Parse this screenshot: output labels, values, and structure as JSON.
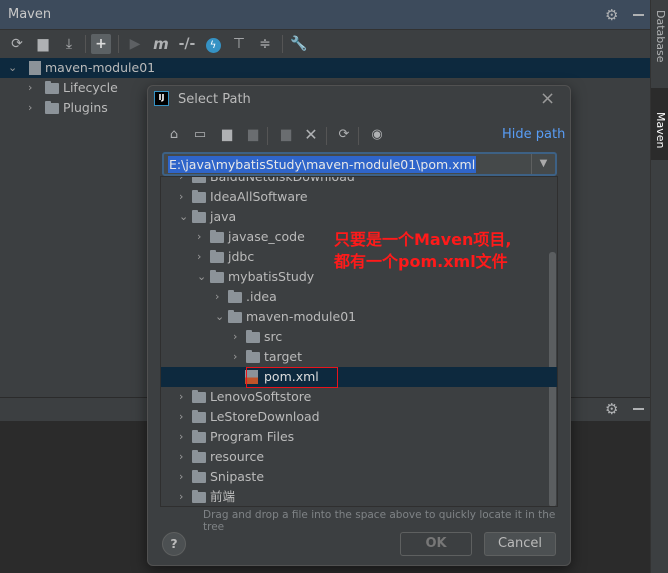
{
  "maven_panel": {
    "title": "Maven",
    "toolbar": [
      "reload-icon",
      "add-folder-icon",
      "download-icon",
      "plus-icon",
      "run-icon",
      "maven-m-icon",
      "skip-tests-icon",
      "offline-icon",
      "expand-all-icon",
      "collapse-all-icon",
      "wrench-icon"
    ],
    "tree": [
      {
        "label": "maven-module01",
        "level": 0,
        "expanded": true,
        "selected": true
      },
      {
        "label": "Lifecycle",
        "level": 1,
        "expanded": false
      },
      {
        "label": "Plugins",
        "level": 1,
        "expanded": false
      }
    ]
  },
  "right_strip": {
    "tabs": [
      "Database",
      "Maven"
    ]
  },
  "dialog": {
    "title": "Select Path",
    "hide_path": "Hide path",
    "path_value": "E:\\java\\mybatisStudy\\maven-module01\\pom.xml",
    "tree": [
      {
        "label": "BaiduNetdiskDownload",
        "level": 0,
        "chev": ">",
        "partial": true
      },
      {
        "label": "IdeaAllSoftware",
        "level": 0,
        "chev": ">"
      },
      {
        "label": "java",
        "level": 0,
        "chev": "v"
      },
      {
        "label": "javase_code",
        "level": 1,
        "chev": ">"
      },
      {
        "label": "jdbc",
        "level": 1,
        "chev": ">"
      },
      {
        "label": "mybatisStudy",
        "level": 1,
        "chev": "v"
      },
      {
        "label": ".idea",
        "level": 2,
        "chev": ">"
      },
      {
        "label": "maven-module01",
        "level": 2,
        "chev": "v"
      },
      {
        "label": "src",
        "level": 3,
        "chev": ">"
      },
      {
        "label": "target",
        "level": 3,
        "chev": ">"
      },
      {
        "label": "pom.xml",
        "level": 3,
        "chev": "",
        "file": true,
        "selected": true
      },
      {
        "label": "LenovoSoftstore",
        "level": 0,
        "chev": ">"
      },
      {
        "label": "LeStoreDownload",
        "level": 0,
        "chev": ">"
      },
      {
        "label": "Program Files",
        "level": 0,
        "chev": ">"
      },
      {
        "label": "resource",
        "level": 0,
        "chev": ">"
      },
      {
        "label": "Snipaste",
        "level": 0,
        "chev": ">"
      },
      {
        "label": "前端",
        "level": 0,
        "chev": ">"
      }
    ],
    "hint": "Drag and drop a file into the space above to quickly locate it in the tree",
    "ok": "OK",
    "cancel": "Cancel",
    "help": "?"
  },
  "annotation": {
    "line1": "只要是一个Maven项目,",
    "line2": "都有一个pom.xml文件",
    "color": "#ff1a1a"
  }
}
